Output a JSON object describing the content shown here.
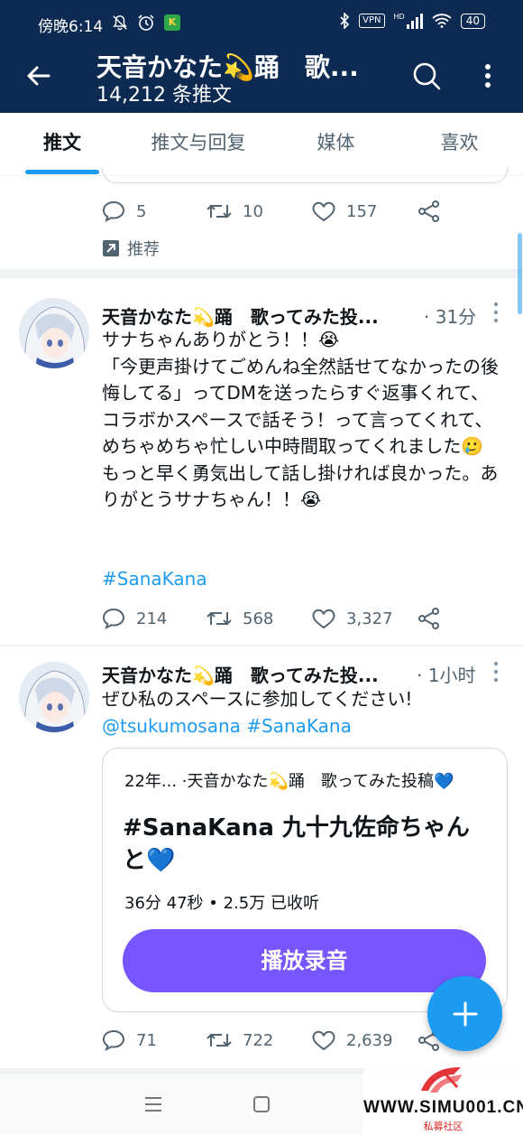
{
  "status_bar": {
    "time": "傍晚6:14",
    "vpn": "VPN",
    "network": "HD",
    "battery": "40"
  },
  "header": {
    "title": "天音かなた💫踊　歌...",
    "subtitle": "14,212 条推文"
  },
  "tabs": [
    {
      "label": "推文",
      "active": true
    },
    {
      "label": "推文与回复",
      "active": false
    },
    {
      "label": "媒体",
      "active": false
    },
    {
      "label": "喜欢",
      "active": false
    }
  ],
  "prev_tweet": {
    "replies": "5",
    "retweets": "10",
    "likes": "157",
    "promoted_label": "推荐"
  },
  "tweets": [
    {
      "author": "天音かなた💫踊　歌ってみた投...",
      "time": "· 31分",
      "text": "サナちゃんありがとう！！😭\n「今更声掛けてごめんね全然話せてなかったの後悔してる」ってDMを送ったらすぐ返事くれて、コラボかスペースで話そう！って言ってくれて、めちゃめちゃ忙しい中時間取ってくれました🥲\nもっと早く勇気出して話し掛ければ良かった。ありがとうサナちゃん！！😭",
      "hashtag": "#SanaKana",
      "replies": "214",
      "retweets": "568",
      "likes": "3,327"
    },
    {
      "author": "天音かなた💫踊　歌ってみた投...",
      "time": "· 1小时",
      "text": "ぜひ私のスペースに参加してください!",
      "mention": "@tsukumosana",
      "hashtag": "#SanaKana",
      "space_card": {
        "meta": "22年... ·天音かなた💫踊　歌ってみた投稿💙",
        "title": "#SanaKana 九十九佐命ちゃんと💙",
        "stats": "36分 47秒 • 2.5万 已收听",
        "play_label": "播放录音"
      },
      "replies": "71",
      "retweets": "722",
      "likes": "2,639"
    }
  ],
  "watermark": {
    "url": "WWW.SIMU001.CN",
    "sub": "私募社区"
  },
  "colors": {
    "header_bg": "#0d2b52",
    "accent": "#1d9bf0",
    "space_purple": "#7856ff",
    "muted": "#536471"
  }
}
